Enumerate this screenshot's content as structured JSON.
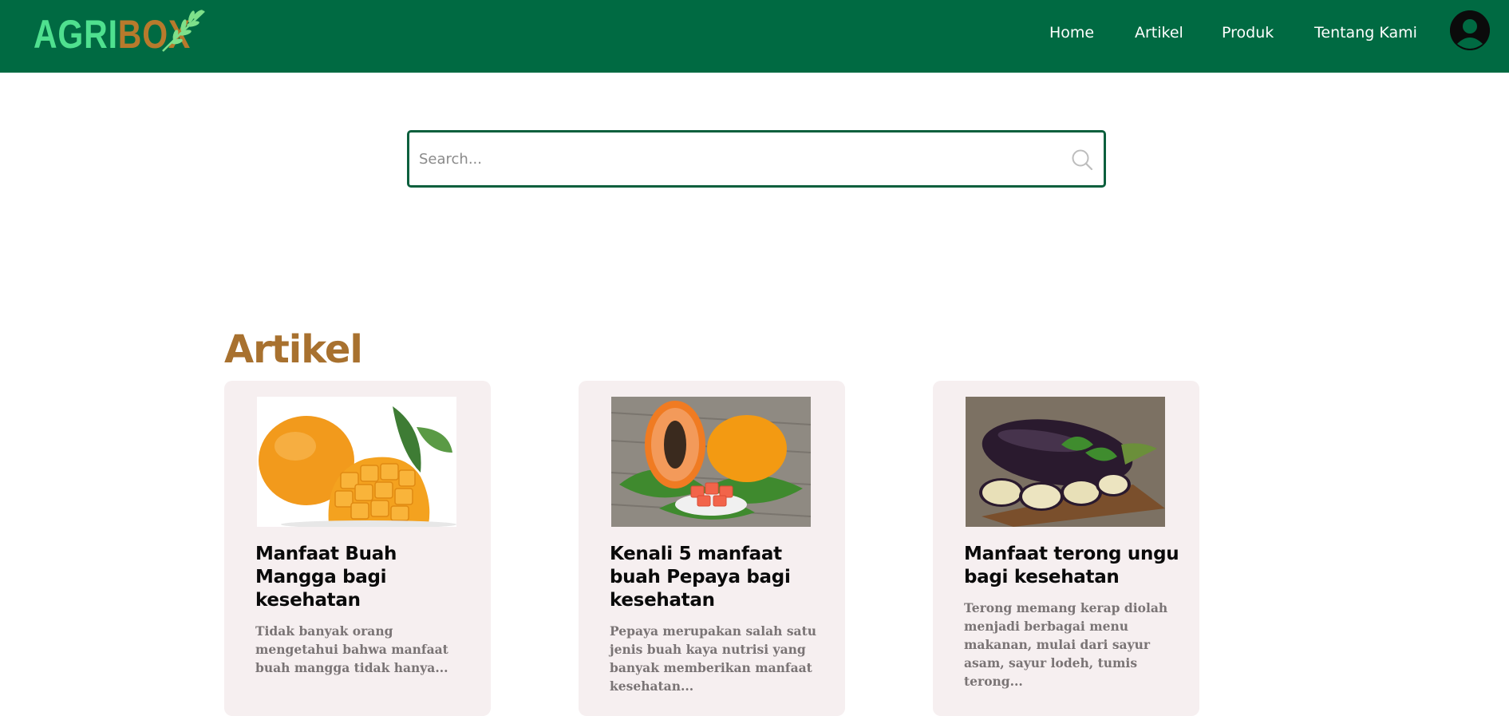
{
  "logo": {
    "part1": "AGRI",
    "part2": "BOX"
  },
  "nav": {
    "items": [
      {
        "label": "Home"
      },
      {
        "label": "Artikel"
      },
      {
        "label": "Produk"
      },
      {
        "label": "Tentang Kami"
      }
    ]
  },
  "search": {
    "placeholder": "Search...",
    "value": ""
  },
  "section": {
    "title": "Artikel"
  },
  "articles": [
    {
      "title": "Manfaat Buah Mangga bagi kesehatan",
      "excerpt": "Tidak banyak orang mengetahui bahwa manfaat buah mangga tidak hanya...",
      "image": "mango"
    },
    {
      "title": "Kenali 5 manfaat buah Pepaya bagi kesehatan",
      "excerpt": "Pepaya merupakan salah satu jenis buah kaya nutrisi yang banyak memberikan manfaat kesehatan...",
      "image": "papaya"
    },
    {
      "title": "Manfaat terong ungu bagi kesehatan",
      "excerpt": "Terong memang kerap diolah menjadi berbagai menu makanan, mulai dari sayur asam, sayur lodeh, tumis terong...",
      "image": "eggplant"
    }
  ],
  "colors": {
    "navbar": "#006a42",
    "accent_brown": "#a8712f",
    "card_bg": "#f6eff0",
    "search_border": "#0b5f3d"
  }
}
